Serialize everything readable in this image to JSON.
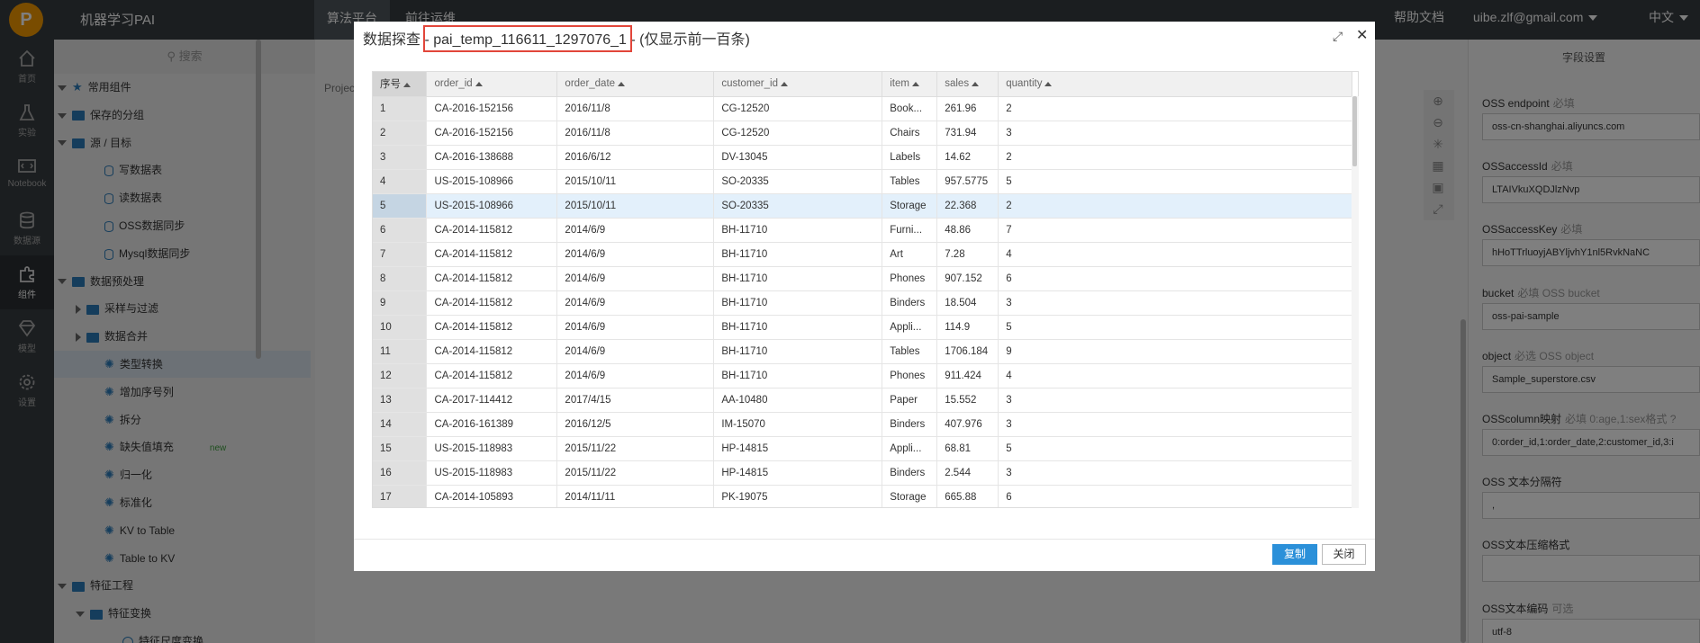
{
  "topbar": {
    "app_name": "机器学习PAI",
    "logo_text": "P",
    "tabs": [
      "算法平台",
      "前往运维"
    ],
    "help": "帮助文档",
    "user": "uibe.zlf@gmail.com",
    "lang": "中文"
  },
  "iconbar": {
    "items": [
      {
        "label": "首页",
        "icon": "home-icon"
      },
      {
        "label": "实验",
        "icon": "flask-icon"
      },
      {
        "label": "Notebook",
        "icon": "notebook-icon"
      },
      {
        "label": "数据源",
        "icon": "database-icon"
      },
      {
        "label": "组件",
        "icon": "puzzle-icon"
      },
      {
        "label": "模型",
        "icon": "diamond-icon"
      },
      {
        "label": "设置",
        "icon": "gear-icon"
      }
    ]
  },
  "component_panel": {
    "search_placeholder": "搜索",
    "tree": [
      {
        "label": "常用组件",
        "kind": "star",
        "level": 0,
        "expand": "down"
      },
      {
        "label": "保存的分组",
        "kind": "folder",
        "level": 0,
        "expand": "down"
      },
      {
        "label": "源 / 目标",
        "kind": "folder",
        "level": 0,
        "expand": "down"
      },
      {
        "label": "写数据表",
        "kind": "cyl",
        "level": 2
      },
      {
        "label": "读数据表",
        "kind": "cyl",
        "level": 2
      },
      {
        "label": "OSS数据同步",
        "kind": "cyl",
        "level": 2
      },
      {
        "label": "Mysql数据同步",
        "kind": "cyl",
        "level": 2
      },
      {
        "label": "数据预处理",
        "kind": "folder",
        "level": 0,
        "expand": "down"
      },
      {
        "label": "采样与过滤",
        "kind": "folder",
        "level": 1,
        "expand": "right"
      },
      {
        "label": "数据合并",
        "kind": "folder",
        "level": 1,
        "expand": "right"
      },
      {
        "label": "类型转换",
        "kind": "sparkle",
        "level": 2,
        "selected": true
      },
      {
        "label": "增加序号列",
        "kind": "sparkle",
        "level": 2
      },
      {
        "label": "拆分",
        "kind": "sparkle",
        "level": 2
      },
      {
        "label": "缺失值填充",
        "kind": "sparkle",
        "level": 2,
        "badge": "new"
      },
      {
        "label": "归一化",
        "kind": "sparkle",
        "level": 2
      },
      {
        "label": "标准化",
        "kind": "sparkle",
        "level": 2
      },
      {
        "label": "KV to Table",
        "kind": "sparkle",
        "level": 2
      },
      {
        "label": "Table to KV",
        "kind": "sparkle",
        "level": 2
      },
      {
        "label": "特征工程",
        "kind": "folder",
        "level": 0,
        "expand": "down"
      },
      {
        "label": "特征变换",
        "kind": "folder",
        "level": 1,
        "expand": "down"
      },
      {
        "label": "特征尺度变换",
        "kind": "circ",
        "level": 3
      }
    ]
  },
  "canvas": {
    "project_label": "Projec"
  },
  "right_panel": {
    "title": "字段设置",
    "fields": [
      {
        "label": "OSS endpoint",
        "hint": "必填",
        "value": "oss-cn-shanghai.aliyuncs.com"
      },
      {
        "label": "OSSaccessId",
        "hint": "必填",
        "value": "LTAIVkuXQDJlzNvp"
      },
      {
        "label": "OSSaccessKey",
        "hint": "必填",
        "value": "hHoTTrluoyjABYljvhY1nl5RvkNaNC"
      },
      {
        "label": "bucket",
        "hint": "必填 OSS bucket",
        "value": "oss-pai-sample"
      },
      {
        "label": "object",
        "hint": "必选 OSS object",
        "value": "Sample_superstore.csv"
      },
      {
        "label": "OSScolumn映射",
        "hint": "必填 0:age,1:sex格式 ?",
        "value": "0:order_id,1:order_date,2:customer_id,3:i"
      },
      {
        "label": "OSS 文本分隔符",
        "hint": "",
        "value": ","
      },
      {
        "label": "OSS文本压缩格式",
        "hint": "",
        "value": ""
      },
      {
        "label": "OSS文本编码",
        "hint": "可选",
        "value": "utf-8"
      }
    ]
  },
  "modal": {
    "title_prefix": "数据探查 - ",
    "table_name": "pai_temp_116611_1297076_1",
    "title_suffix": " - (仅显示前一百条)",
    "expand_icon": "expand-icon",
    "close_icon": "close-icon",
    "copy_btn": "复制",
    "close_btn": "关闭",
    "columns": [
      "序号",
      "order_id",
      "order_date",
      "customer_id",
      "item",
      "sales",
      "quantity"
    ],
    "rows": [
      [
        "1",
        "CA-2016-152156",
        "2016/11/8",
        "CG-12520",
        "Book...",
        "261.96",
        "2"
      ],
      [
        "2",
        "CA-2016-152156",
        "2016/11/8",
        "CG-12520",
        "Chairs",
        "731.94",
        "3"
      ],
      [
        "3",
        "CA-2016-138688",
        "2016/6/12",
        "DV-13045",
        "Labels",
        "14.62",
        "2"
      ],
      [
        "4",
        "US-2015-108966",
        "2015/10/11",
        "SO-20335",
        "Tables",
        "957.5775",
        "5"
      ],
      [
        "5",
        "US-2015-108966",
        "2015/10/11",
        "SO-20335",
        "Storage",
        "22.368",
        "2"
      ],
      [
        "6",
        "CA-2014-115812",
        "2014/6/9",
        "BH-11710",
        "Furni...",
        "48.86",
        "7"
      ],
      [
        "7",
        "CA-2014-115812",
        "2014/6/9",
        "BH-11710",
        "Art",
        "7.28",
        "4"
      ],
      [
        "8",
        "CA-2014-115812",
        "2014/6/9",
        "BH-11710",
        "Phones",
        "907.152",
        "6"
      ],
      [
        "9",
        "CA-2014-115812",
        "2014/6/9",
        "BH-11710",
        "Binders",
        "18.504",
        "3"
      ],
      [
        "10",
        "CA-2014-115812",
        "2014/6/9",
        "BH-11710",
        "Appli...",
        "114.9",
        "5"
      ],
      [
        "11",
        "CA-2014-115812",
        "2014/6/9",
        "BH-11710",
        "Tables",
        "1706.184",
        "9"
      ],
      [
        "12",
        "CA-2014-115812",
        "2014/6/9",
        "BH-11710",
        "Phones",
        "911.424",
        "4"
      ],
      [
        "13",
        "CA-2017-114412",
        "2017/4/15",
        "AA-10480",
        "Paper",
        "15.552",
        "3"
      ],
      [
        "14",
        "CA-2016-161389",
        "2016/12/5",
        "IM-15070",
        "Binders",
        "407.976",
        "3"
      ],
      [
        "15",
        "US-2015-118983",
        "2015/11/22",
        "HP-14815",
        "Appli...",
        "68.81",
        "5"
      ],
      [
        "16",
        "US-2015-118983",
        "2015/11/22",
        "HP-14815",
        "Binders",
        "2.544",
        "3"
      ],
      [
        "17",
        "CA-2014-105893",
        "2014/11/11",
        "PK-19075",
        "Storage",
        "665.88",
        "6"
      ]
    ],
    "highlight_row": 4
  }
}
